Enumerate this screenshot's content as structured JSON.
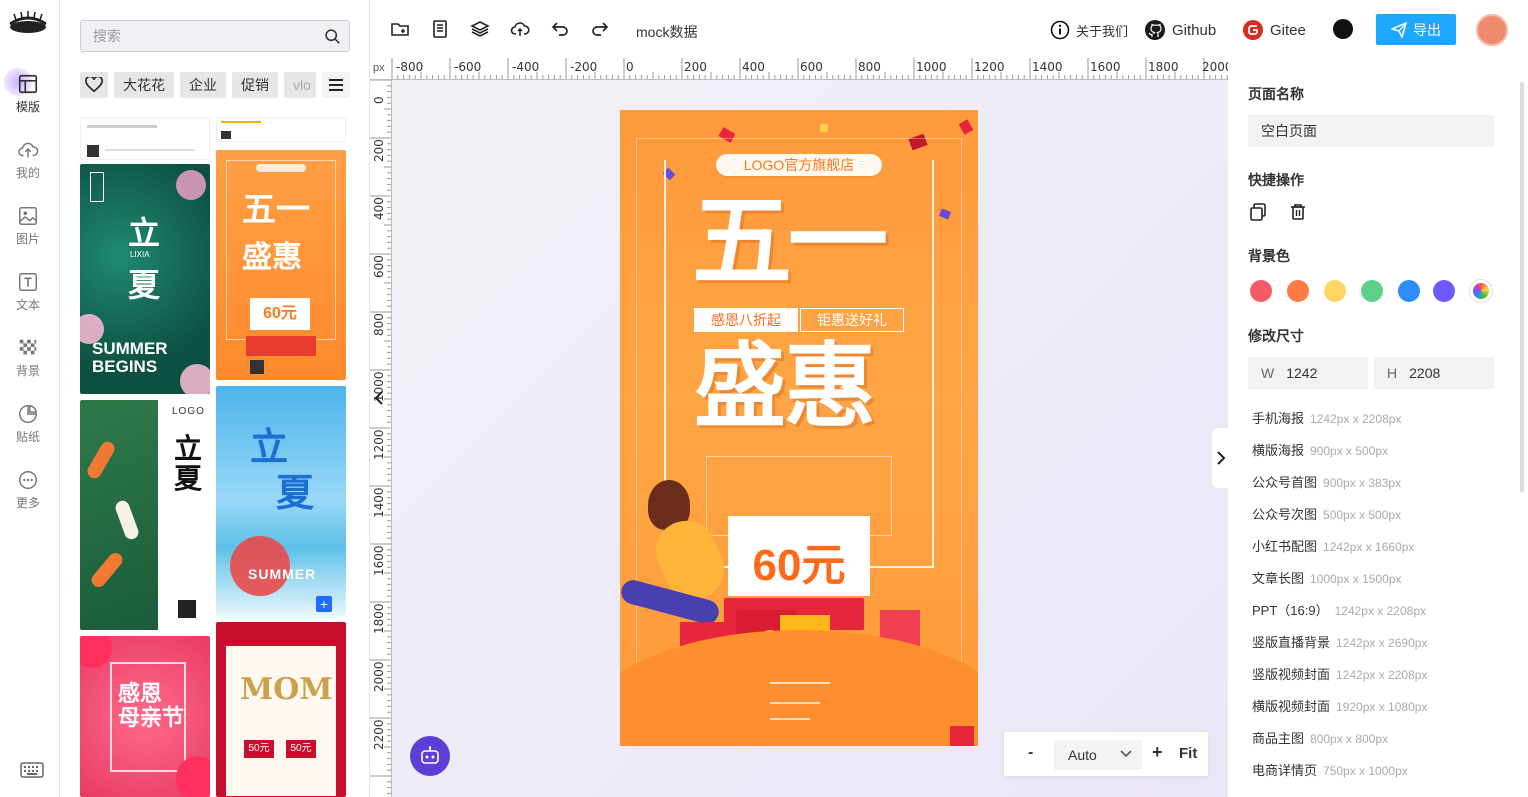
{
  "sidebar": {
    "items": [
      {
        "label": "模版",
        "icon": "template-icon"
      },
      {
        "label": "我的",
        "icon": "cloud-upload-icon"
      },
      {
        "label": "图片",
        "icon": "image-icon"
      },
      {
        "label": "文本",
        "icon": "text-icon"
      },
      {
        "label": "背景",
        "icon": "checker-icon"
      },
      {
        "label": "贴纸",
        "icon": "sticker-icon"
      },
      {
        "label": "更多",
        "icon": "more-icon"
      }
    ]
  },
  "templates": {
    "search_placeholder": "搜索",
    "tags": [
      "大花花",
      "企业",
      "促销",
      "vlo"
    ],
    "thumbs": [
      {
        "title": "立夏",
        "sub": "LIXIA",
        "en": "SUMMER BEGINS"
      },
      {
        "title": "五一盛惠",
        "price": "60元"
      },
      {
        "title": "立夏",
        "logo": "LOGO"
      },
      {
        "title": "立夏",
        "en": "SUMMER"
      },
      {
        "title": "感恩母亲节"
      },
      {
        "title": "MOM",
        "price1": "50元",
        "price2": "50元"
      }
    ]
  },
  "toolbar": {
    "title": "mock数据",
    "about": "关于我们",
    "github": "Github",
    "gitee": "Gitee",
    "export": "导出"
  },
  "ruler": {
    "unit": "px",
    "h_ticks": [
      "-800",
      "-600",
      "-400",
      "-200",
      "0",
      "200",
      "400",
      "600",
      "800",
      "1000",
      "1200",
      "1400",
      "1600",
      "1800",
      "2000"
    ],
    "v_ticks": [
      "0",
      "200",
      "400",
      "600",
      "800",
      "1000",
      "1200",
      "1400",
      "1600",
      "1800",
      "2000",
      "2200"
    ]
  },
  "poster": {
    "store": "LOGO官方旗舰店",
    "headline_top": "五一",
    "headline_bottom": "盛惠",
    "tag_left": "感恩八折起",
    "tag_right": "钜惠送好礼",
    "price": "60元"
  },
  "zoom": {
    "minus": "-",
    "value": "Auto",
    "plus": "+",
    "fit": "Fit"
  },
  "props": {
    "page_name_label": "页面名称",
    "page_name": "空白页面",
    "quick_label": "快捷操作",
    "bg_label": "背景色",
    "bg_colors": [
      "#f45b69",
      "#ff7a45",
      "#ffd666",
      "#5fcf8c",
      "#2f8cff",
      "#6e5bff"
    ],
    "size_label": "修改尺寸",
    "width_key": "W",
    "width": "1242",
    "height_key": "H",
    "height": "2208",
    "presets": [
      {
        "name": "手机海报",
        "size": "1242px x 2208px"
      },
      {
        "name": "横版海报",
        "size": "900px x 500px"
      },
      {
        "name": "公众号首图",
        "size": "900px x 383px"
      },
      {
        "name": "公众号次图",
        "size": "500px x 500px"
      },
      {
        "name": "小红书配图",
        "size": "1242px x 1660px"
      },
      {
        "name": "文章长图",
        "size": "1000px x 1500px"
      },
      {
        "name": "PPT（16:9）",
        "size": "1242px x 2208px"
      },
      {
        "name": "竖版直播背景",
        "size": "1242px x 2690px"
      },
      {
        "name": "竖版视频封面",
        "size": "1242px x 2208px"
      },
      {
        "name": "横版视频封面",
        "size": "1920px x 1080px"
      },
      {
        "name": "商品主图",
        "size": "800px x 800px"
      },
      {
        "name": "电商详情页",
        "size": "750px x 1000px"
      }
    ]
  }
}
